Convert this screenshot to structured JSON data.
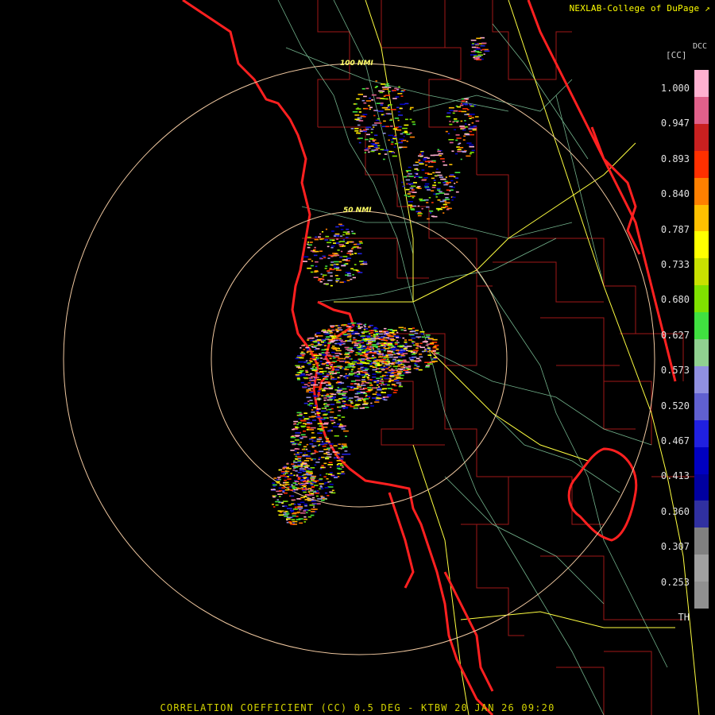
{
  "credit": "NEXLAB-College of DuPage ↗",
  "caption": "CORRELATION COEFFICIENT (CC) 0.5 DEG - KTBW 20 JAN 26 09:20",
  "legend": {
    "product": "DCC",
    "unit": "[CC]",
    "ticks": [
      "1.000",
      "0.947",
      "0.893",
      "0.840",
      "0.787",
      "0.733",
      "0.680",
      "0.627",
      "0.573",
      "0.520",
      "0.467",
      "0.413",
      "0.360",
      "0.307",
      "0.253",
      "TH"
    ],
    "colors": [
      "#ffb0d0",
      "#e0608a",
      "#c82020",
      "#ff3000",
      "#ff8000",
      "#ffc000",
      "#ffff00",
      "#c8e000",
      "#80e000",
      "#40e040",
      "#90d090",
      "#9090e0",
      "#6060d0",
      "#2020e0",
      "#0000c0",
      "#0000a0",
      "#3030a0",
      "#808080",
      "#a0a0a0",
      "#909090",
      "#000000"
    ]
  },
  "rings": [
    {
      "label": "100 NMI"
    },
    {
      "label": "50 NMI"
    }
  ],
  "colors": {
    "coast": "#ff2020",
    "county": "#a01818",
    "highway": "#ffff40",
    "road": "#90e0b0",
    "ring": "#f0c8a0"
  }
}
